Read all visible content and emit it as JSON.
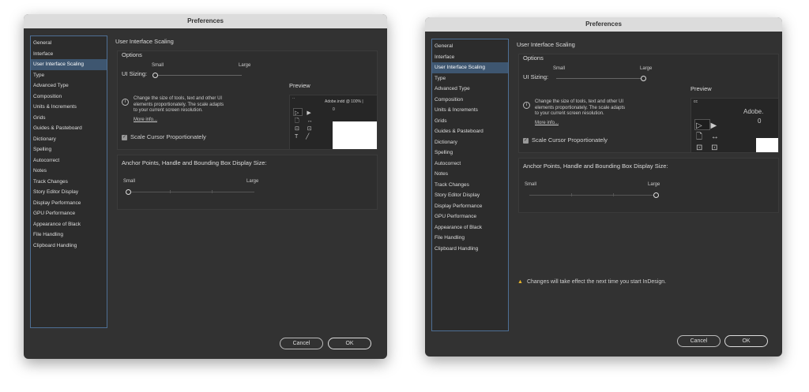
{
  "colors": {
    "accent": "#3e5670",
    "sidebar_border": "#4e6f95",
    "warning": "#e8b52a"
  },
  "dialogs": [
    {
      "title": "Preferences",
      "sidebar": [
        "General",
        "Interface",
        "User Interface Scaling",
        "Type",
        "Advanced Type",
        "Composition",
        "Units & Increments",
        "Grids",
        "Guides & Pasteboard",
        "Dictionary",
        "Spelling",
        "Autocorrect",
        "Notes",
        "Track Changes",
        "Story Editor Display",
        "Display Performance",
        "GPU Performance",
        "Appearance of Black",
        "File Handling",
        "Clipboard Handling"
      ],
      "selected": 2,
      "heading": "User Interface Scaling",
      "options_label": "Options",
      "ui_small": "Small",
      "ui_large": "Large",
      "ui_sizing_label": "UI Sizing:",
      "ui_sizing_value": 0,
      "preview_label": "Preview",
      "info_text": [
        "Change the size of tools, text and other UI",
        "elements proportionately. The scale adapts",
        "to your current screen resolution."
      ],
      "more_info": "More info...",
      "scale_cursor": "Scale Cursor Proportionately",
      "scale_cursor_checked": true,
      "anchor_label": "Anchor Points, Handle and Bounding Box Display Size:",
      "anchor_small": "Small",
      "anchor_large": "Large",
      "anchor_value": 0,
      "preview_tab": "Adobe.indd @ 100% |",
      "preview_zero": "0",
      "preview_zero2": "0",
      "preview_top": "··",
      "cancel": "Cancel",
      "ok": "OK"
    },
    {
      "title": "Preferences",
      "sidebar": [
        "General",
        "Interface",
        "User Interface Scaling",
        "Type",
        "Advanced Type",
        "Composition",
        "Units & Increments",
        "Grids",
        "Guides & Pasteboard",
        "Dictionary",
        "Spelling",
        "Autocorrect",
        "Notes",
        "Track Changes",
        "Story Editor Display",
        "Display Performance",
        "GPU Performance",
        "Appearance of Black",
        "File Handling",
        "Clipboard Handling"
      ],
      "selected": 2,
      "heading": "User Interface Scaling",
      "options_label": "Options",
      "ui_small": "Small",
      "ui_large": "Large",
      "ui_sizing_label": "UI Sizing:",
      "ui_sizing_value": 1,
      "preview_label": "Preview",
      "info_text": [
        "Change the size of tools, text and other UI",
        "elements proportionately. The scale adapts",
        "to your current screen resolution."
      ],
      "more_info": "More info...",
      "scale_cursor": "Scale Cursor Proportionately",
      "scale_cursor_checked": true,
      "anchor_label": "Anchor Points, Handle and Bounding Box Display Size:",
      "anchor_small": "Small",
      "anchor_large": "Large",
      "anchor_value": 1,
      "preview_tab": "Adobe.",
      "preview_zero": "0",
      "preview_zero2": "0",
      "preview_top": "cc",
      "warning": "Changes will take effect the next time you start InDesign.",
      "cancel": "Cancel",
      "ok": "OK"
    }
  ]
}
